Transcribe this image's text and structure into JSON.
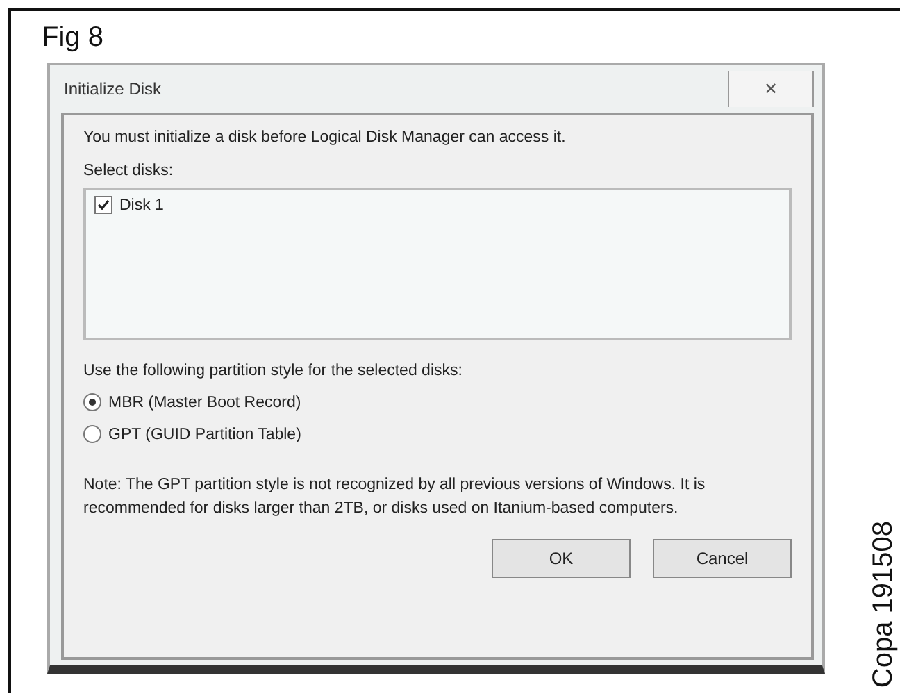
{
  "caption": "Fig 8",
  "dialog": {
    "title": "Initialize Disk",
    "close": "✕",
    "message": "You must initialize a disk before Logical Disk Manager can access it.",
    "select_label": "Select disks:",
    "disks": [
      {
        "label": "Disk 1",
        "checked": true
      }
    ],
    "style_label": "Use the following partition style for the selected disks:",
    "styles": [
      {
        "label": "MBR (Master Boot Record)",
        "selected": true
      },
      {
        "label": "GPT (GUID Partition Table)",
        "selected": false
      }
    ],
    "note": "Note: The GPT partition style is not recognized by all previous versions of Windows. It is recommended for disks larger than 2TB, or disks used on Itanium-based computers.",
    "buttons": [
      "OK",
      "Cancel"
    ]
  },
  "side_label": "Copa 191508"
}
